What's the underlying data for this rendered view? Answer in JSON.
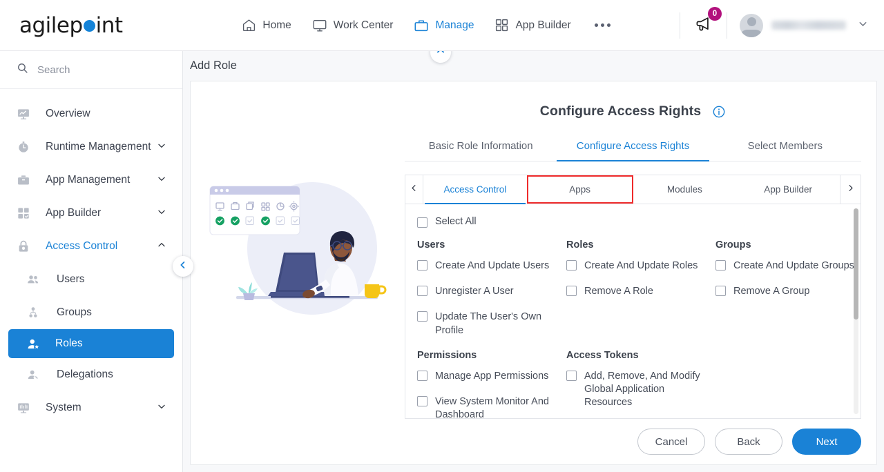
{
  "brand": {
    "name_part1": "agilep",
    "name_part2": "int",
    "dot_color": "#1483d8"
  },
  "header": {
    "nav": [
      {
        "label": "Home",
        "icon": "home-icon",
        "active": false
      },
      {
        "label": "Work Center",
        "icon": "monitor-icon",
        "active": false
      },
      {
        "label": "Manage",
        "icon": "briefcase-icon",
        "active": true
      },
      {
        "label": "App Builder",
        "icon": "grid-icon",
        "active": false
      }
    ],
    "more_label": "more-options",
    "notification_count": "0",
    "notification_icon": "megaphone-icon",
    "badge_color": "#b2117d",
    "account_caret": "chevron-down-icon"
  },
  "sidebar": {
    "search_placeholder": "Search",
    "search_value": "",
    "items": [
      {
        "label": "Overview",
        "icon": "chart-monitor-icon",
        "expandable": false,
        "state": "normal"
      },
      {
        "label": "Runtime Management",
        "icon": "clock-icon",
        "expandable": true,
        "state": "normal",
        "chevron": "chevron-down-icon"
      },
      {
        "label": "App Management",
        "icon": "briefcase-icon",
        "expandable": true,
        "state": "normal",
        "chevron": "chevron-down-icon"
      },
      {
        "label": "App Builder",
        "icon": "grid-icon",
        "expandable": true,
        "state": "normal",
        "chevron": "chevron-down-icon"
      },
      {
        "label": "Access Control",
        "icon": "lock-icon",
        "expandable": true,
        "state": "active-blue",
        "chevron": "chevron-up-icon"
      },
      {
        "label": "Users",
        "icon": "users-icon",
        "expandable": false,
        "state": "sub"
      },
      {
        "label": "Groups",
        "icon": "group-tree-icon",
        "expandable": false,
        "state": "sub"
      },
      {
        "label": "Roles",
        "icon": "user-role-icon",
        "expandable": false,
        "state": "selected"
      },
      {
        "label": "Delegations",
        "icon": "user-delegate-icon",
        "expandable": false,
        "state": "sub"
      },
      {
        "label": "System",
        "icon": "system-monitor-icon",
        "expandable": true,
        "state": "normal",
        "chevron": "chevron-down-icon"
      }
    ],
    "collapse_icon": "chevron-left-icon"
  },
  "main": {
    "page_title": "Add Role",
    "panel_collapse_icon": "chevron-up-icon",
    "form_heading": "Configure Access Rights",
    "info_icon": "info-icon",
    "tabs": [
      {
        "label": "Basic Role Information",
        "active": false
      },
      {
        "label": "Configure Access Rights",
        "active": true
      },
      {
        "label": "Select Members",
        "active": false
      }
    ],
    "subtabs": {
      "prev_icon": "chevron-left-icon",
      "next_icon": "chevron-right-icon",
      "items": [
        {
          "label": "Access Control",
          "active": true,
          "highlighted": false
        },
        {
          "label": "Apps",
          "active": false,
          "highlighted": true
        },
        {
          "label": "Modules",
          "active": false,
          "highlighted": false
        },
        {
          "label": "App Builder",
          "active": false,
          "highlighted": false
        }
      ],
      "highlight_color": "#ef2b2b"
    },
    "permissions": {
      "select_all_label": "Select All",
      "select_all_checked": false,
      "row1": [
        {
          "title": "Users",
          "items": [
            {
              "label": "Create And Update Users",
              "checked": false
            },
            {
              "label": "Unregister A User",
              "checked": false
            },
            {
              "label": "Update The User's Own Profile",
              "checked": false
            }
          ]
        },
        {
          "title": "Roles",
          "items": [
            {
              "label": "Create And Update Roles",
              "checked": false
            },
            {
              "label": "Remove A Role",
              "checked": false
            }
          ]
        },
        {
          "title": "Groups",
          "items": [
            {
              "label": "Create And Update Groups",
              "checked": false
            },
            {
              "label": "Remove A Group",
              "checked": false
            }
          ]
        }
      ],
      "row2": [
        {
          "title": "Permissions",
          "items": [
            {
              "label": "Manage App Permissions",
              "checked": false
            },
            {
              "label": "View System Monitor And Dashboard",
              "checked": false
            }
          ]
        },
        {
          "title": "Access Tokens",
          "items": [
            {
              "label": "Add, Remove, And Modify Global Application Resources",
              "checked": false
            }
          ]
        }
      ]
    },
    "footer_buttons": [
      {
        "label": "Cancel",
        "style": "outline"
      },
      {
        "label": "Back",
        "style": "outline"
      },
      {
        "label": "Next",
        "style": "primary"
      }
    ]
  },
  "illustration": {
    "name": "person-at-desk-with-permissions-panel",
    "accent_color": "#3f4a7e",
    "check_color": "#16a163"
  },
  "theme": {
    "primary": "#1a82d6",
    "text": "#3d4350",
    "muted": "#8b909c",
    "border": "#e3e5ea"
  }
}
